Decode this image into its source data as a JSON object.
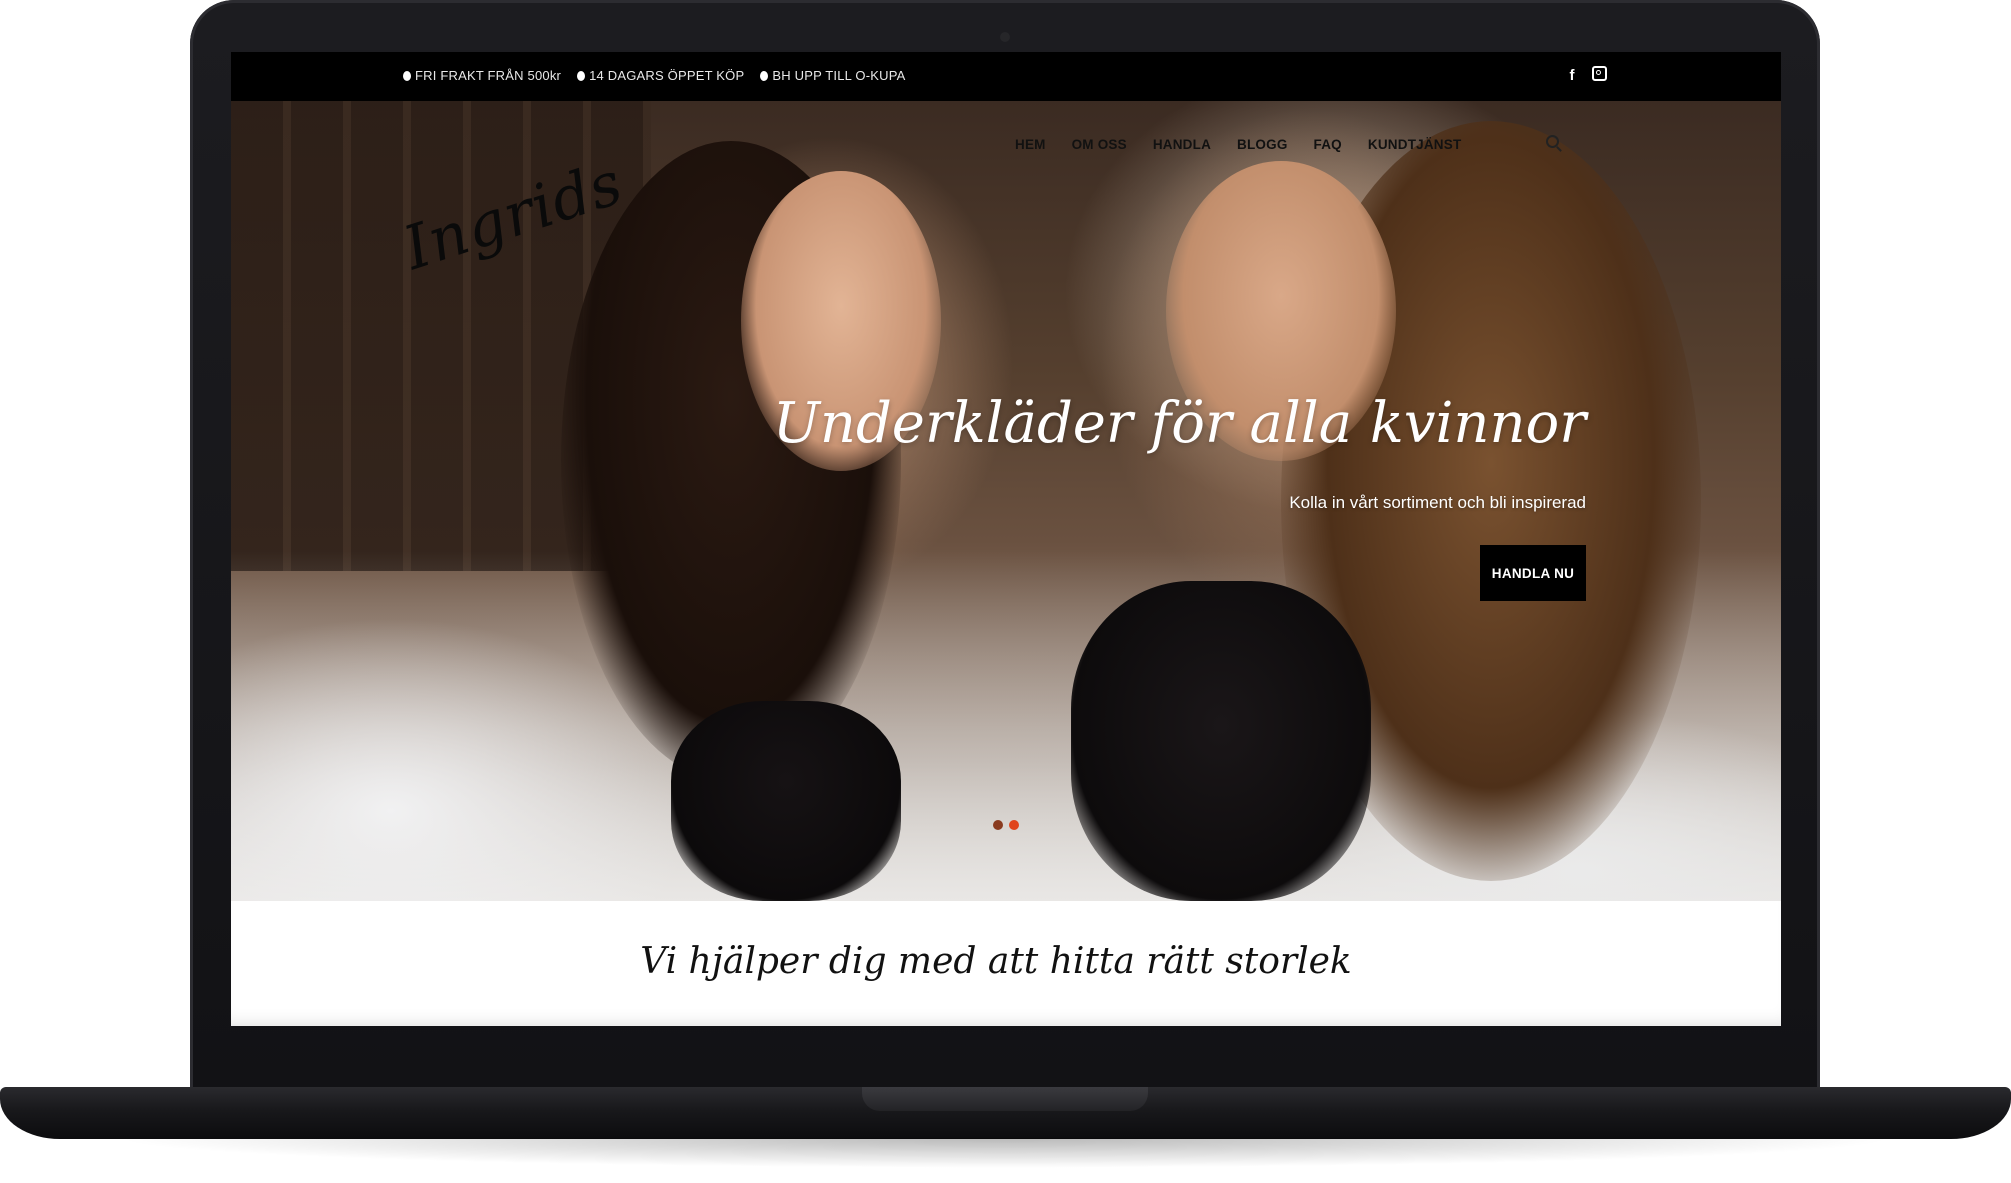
{
  "topbar": {
    "usps": [
      "FRI FRAKT FRÅN 500kr",
      "14 DAGARS ÖPPET KÖP",
      "BH UPP TILL O-KUPA"
    ],
    "social_icons": [
      "facebook-icon",
      "instagram-icon"
    ]
  },
  "header": {
    "logo": "Ingrids",
    "nav": [
      "HEM",
      "OM OSS",
      "HANDLA",
      "BLOGG",
      "FAQ",
      "KUNDTJÄNST"
    ]
  },
  "hero": {
    "headline": "Underkläder för alla kvinnor",
    "subheadline": "Kolla in vårt sortiment och bli inspirerad",
    "cta": "HANDLA NU",
    "slides_count": 2,
    "active_slide": 2
  },
  "section": {
    "title": "Vi hjälper dig med att hitta rätt storlek"
  },
  "colors": {
    "topbar_bg": "#000000",
    "cta_bg": "#000000",
    "slider_dot_active": "#e0451c",
    "laptop_body": "#16161a"
  }
}
